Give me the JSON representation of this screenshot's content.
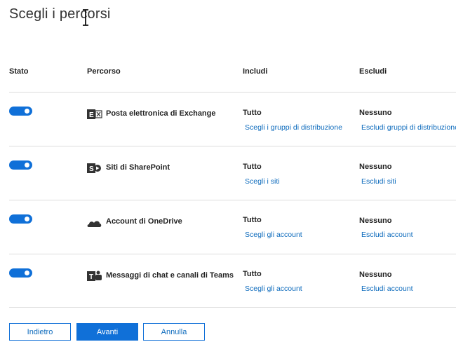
{
  "page": {
    "title": "Scegli i percorsi"
  },
  "table": {
    "headers": {
      "status": "Stato",
      "location": "Percorso",
      "include": "Includi",
      "exclude": "Escludi"
    },
    "rows": [
      {
        "name": "Posta elettronica di Exchange",
        "icon": "exchange-icon",
        "enabled": true,
        "include_value": "Tutto",
        "include_link": "Scegli i gruppi di distribuzione",
        "exclude_value": "Nessuno",
        "exclude_link": "Escludi gruppi di distribuzione"
      },
      {
        "name": "Siti di SharePoint",
        "icon": "sharepoint-icon",
        "enabled": true,
        "include_value": "Tutto",
        "include_link": "Scegli i siti",
        "exclude_value": "Nessuno",
        "exclude_link": "Escludi siti"
      },
      {
        "name": "Account di OneDrive",
        "icon": "onedrive-icon",
        "enabled": true,
        "include_value": "Tutto",
        "include_link": "Scegli gli account",
        "exclude_value": "Nessuno",
        "exclude_link": "Escludi account"
      },
      {
        "name": "Messaggi di chat e canali di Teams",
        "icon": "teams-icon",
        "enabled": true,
        "include_value": "Tutto",
        "include_link": "Scegli gli account",
        "exclude_value": "Nessuno",
        "exclude_link": "Escludi account"
      }
    ]
  },
  "buttons": {
    "back": "Indietro",
    "next": "Avanti",
    "cancel": "Annulla"
  },
  "colors": {
    "accent": "#1070d8",
    "link": "#0f6cbd",
    "divider": "#dcdcdc"
  }
}
